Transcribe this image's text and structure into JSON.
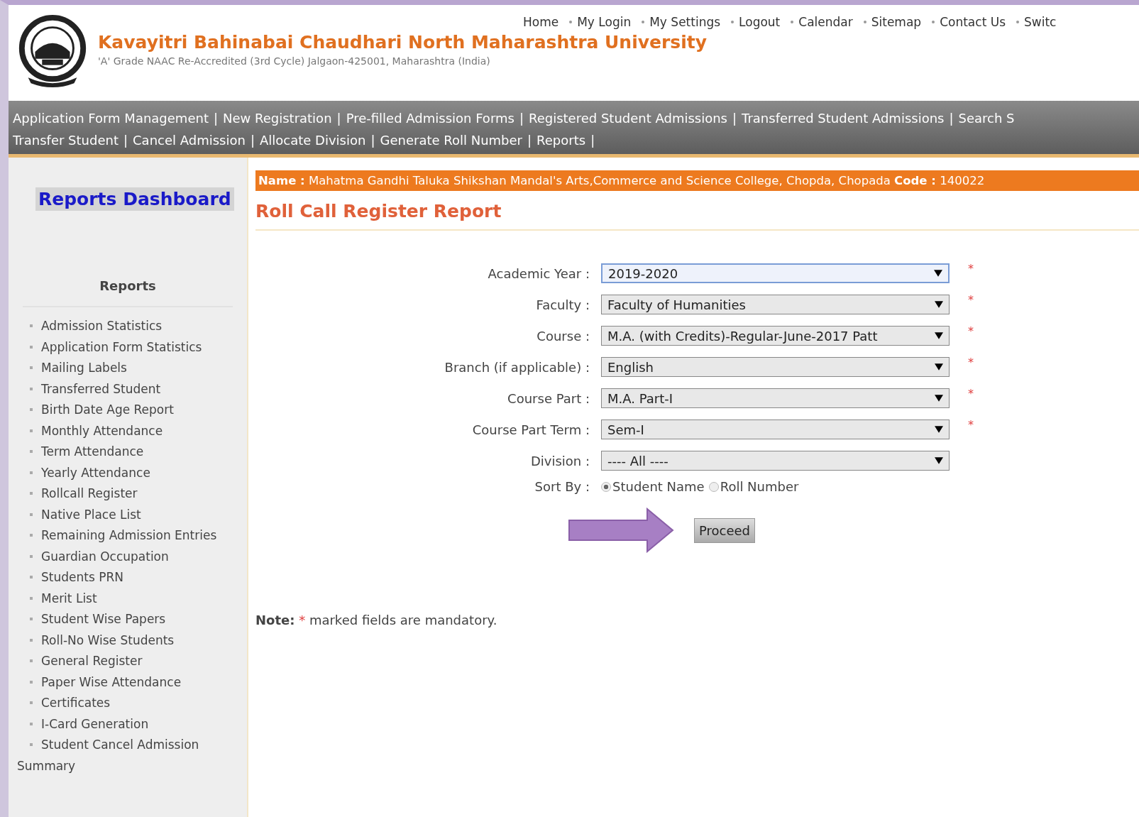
{
  "header": {
    "title": "Kavayitri Bahinabai Chaudhari North Maharashtra University",
    "subtitle": "'A' Grade NAAC Re-Accredited (3rd Cycle) Jalgaon-425001, Maharashtra (India)"
  },
  "top_links": [
    "Home",
    "My Login",
    "My Settings",
    "Logout",
    "Calendar",
    "Sitemap",
    "Contact Us",
    "Switc"
  ],
  "nav_menu": {
    "separator": "|",
    "line_1": [
      "Application Form Management",
      "New Registration",
      "Pre-filled Admission Forms",
      "Registered Student Admissions",
      "Transferred Student Admissions",
      "Search S"
    ],
    "line_2": [
      "Transfer Student",
      "Cancel Admission",
      "Allocate Division",
      "Generate Roll Number",
      "Reports"
    ]
  },
  "sidebar": {
    "dashboard": "Reports Dashboard",
    "heading": "Reports",
    "items": [
      "Admission Statistics",
      "Application Form Statistics",
      "Mailing Labels",
      "Transferred Student",
      "Birth Date Age Report",
      "Monthly Attendance",
      "Term Attendance",
      "Yearly Attendance",
      "Rollcall Register",
      "Native Place List",
      "Remaining Admission Entries",
      "Guardian Occupation",
      "Students PRN",
      "Merit List",
      "Student Wise Papers",
      "Roll-No Wise Students",
      "General Register",
      "Paper Wise Attendance",
      "Certificates",
      "I-Card Generation",
      "Student Cancel Admission Summary"
    ]
  },
  "banner": "**Name :** Mahatma Gandhi Taluka Shikshan Mandal's Arts,Commerce and Science College, Chopda, Chopada **Code :** 140022",
  "page_title": "Roll Call Register Report",
  "form": {
    "required_mark": "*",
    "fields": [
      {
        "label": "Academic Year :",
        "value": "2019-2020",
        "required": true,
        "focused": true
      },
      {
        "label": "Faculty :",
        "value": "Faculty of Humanities",
        "required": true,
        "focused": false
      },
      {
        "label": "Course :",
        "value": "M.A. (with Credits)-Regular-June-2017 Patt",
        "required": true,
        "focused": false
      },
      {
        "label": "Branch (if applicable) :",
        "value": "English",
        "required": true,
        "focused": false
      },
      {
        "label": "Course Part :",
        "value": "M.A. Part-I",
        "required": true,
        "focused": false
      },
      {
        "label": "Course Part Term :",
        "value": "Sem-I",
        "required": true,
        "focused": false
      },
      {
        "label": "Division :",
        "value": "---- All ----",
        "required": false,
        "focused": false
      }
    ],
    "sort_by": {
      "label": "Sort By :",
      "options": [
        {
          "label": "Student Name",
          "selected": true
        },
        {
          "label": "Roll Number",
          "selected": false
        }
      ]
    },
    "button": "Proceed"
  },
  "note": {
    "label": "Note:",
    "mark": "*",
    "text": "marked fields are mandatory."
  }
}
